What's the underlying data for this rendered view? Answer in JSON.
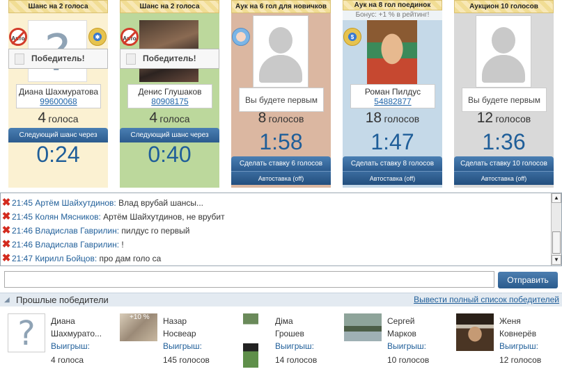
{
  "auctions": [
    {
      "header": "Шанс на 2 голоса",
      "bg": "#fbf1d2",
      "badge_left": "Авто",
      "winner": "Победитель!",
      "name": "Диана Шахмуратова",
      "id": "99600068",
      "votes": "4",
      "votes_word": "голоса",
      "next_label": "Следующий шанс через",
      "timer": "0:24"
    },
    {
      "header": "Шанс на 2 голоса",
      "bg": "#bcd89c",
      "badge_left": "Авто",
      "winner": "Победитель!",
      "name": "Денис Глушаков",
      "id": "80908175",
      "votes": "4",
      "votes_word": "голоса",
      "next_label": "Следующий шанс через",
      "timer": "0:40"
    },
    {
      "header": "Аук на 6 гол для новичков",
      "bg": "#dbb7a1",
      "first": "Вы будете первым",
      "votes": "8",
      "votes_word": "голосов",
      "timer": "1:58",
      "bid_label": "Сделать ставку 6 голосов",
      "auto_label": "Автоставка (off)"
    },
    {
      "header": "Аук на 8 гол поединок",
      "bonus": "Бонус: +1 % в рейтинг!",
      "bg": "#c5d9e8",
      "name": "Роман Пилдус",
      "id": "54882877",
      "votes": "18",
      "votes_word": "голосов",
      "timer": "1:47",
      "bid_label": "Сделать ставку 8 голосов",
      "auto_label": "Автоставка (off)"
    },
    {
      "header": "Аукцион 10 голосов",
      "bg": "#d9d9d9",
      "first": "Вы будете первым",
      "votes": "12",
      "votes_word": "голосов",
      "timer": "1:36",
      "bid_label": "Сделать ставку 10 голосов",
      "auto_label": "Автоставка (off)"
    }
  ],
  "chat": [
    {
      "time": "21:45",
      "user": "Артём Шайхутдинов:",
      "text": "Влад врубай шансы..."
    },
    {
      "time": "21:45",
      "user": "Колян Мясников:",
      "text": "Артём Шайхутдинов, не врубит"
    },
    {
      "time": "21:46",
      "user": "Владислав Гаврилин:",
      "text": "пилдус го первый"
    },
    {
      "time": "21:46",
      "user": "Владислав Гаврилин:",
      "text": "!"
    },
    {
      "time": "21:47",
      "user": "Кирилл Бойцов:",
      "text": "про дам голо са"
    }
  ],
  "send_label": "Отправить",
  "past": {
    "title": "Прошлые победители",
    "link": "Вывести полный список победителей",
    "win_label": "Выигрыш:",
    "winners": [
      {
        "name1": "Диана",
        "name2": "Шахмурато...",
        "amount": "4 голоса"
      },
      {
        "name1": "Назар",
        "name2": "Носвеар",
        "amount": "145 голосов",
        "pic_text": "+10 %"
      },
      {
        "name1": "Діма",
        "name2": "Грошев",
        "amount": "14 голосов"
      },
      {
        "name1": "Сергей",
        "name2": "Марков",
        "amount": "10 голосов"
      },
      {
        "name1": "Женя",
        "name2": "Ковнерёв",
        "amount": "12 голосов"
      }
    ]
  }
}
